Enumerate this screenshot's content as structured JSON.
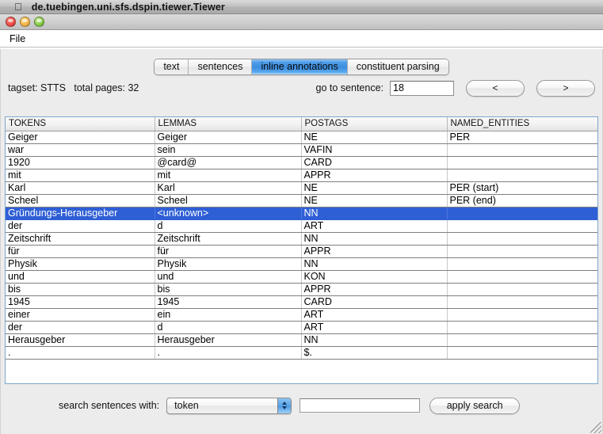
{
  "window": {
    "apple_glyph": "",
    "title": "de.tuebingen.uni.sfs.dspin.tiewer.Tiewer",
    "traffic_lights": [
      "close",
      "minimize",
      "zoom"
    ]
  },
  "menubar": {
    "items": [
      "File"
    ]
  },
  "tabs": [
    {
      "label": "text",
      "active": false
    },
    {
      "label": "sentences",
      "active": false
    },
    {
      "label": "inline annotations",
      "active": true
    },
    {
      "label": "constituent parsing",
      "active": false
    }
  ],
  "info": {
    "tagset_text": "tagset: STTS   total pages: 32",
    "tagset_label": "tagset:",
    "tagset_value": "STTS",
    "total_pages_label": "total pages:",
    "total_pages_value": "32",
    "goto_label": "go to sentence:",
    "goto_value": "18",
    "prev_label": "<",
    "next_label": ">"
  },
  "table": {
    "headers": [
      "TOKENS",
      "LEMMAS",
      "POSTAGS",
      "NAMED_ENTITIES"
    ],
    "selected_row_index": 6,
    "rows": [
      {
        "tokens": "Geiger",
        "lemmas": "Geiger",
        "postags": "NE",
        "named_entities": "PER"
      },
      {
        "tokens": "war",
        "lemmas": "sein",
        "postags": "VAFIN",
        "named_entities": ""
      },
      {
        "tokens": "1920",
        "lemmas": "@card@",
        "postags": "CARD",
        "named_entities": ""
      },
      {
        "tokens": "mit",
        "lemmas": "mit",
        "postags": "APPR",
        "named_entities": ""
      },
      {
        "tokens": "Karl",
        "lemmas": "Karl",
        "postags": "NE",
        "named_entities": "PER (start)"
      },
      {
        "tokens": "Scheel",
        "lemmas": "Scheel",
        "postags": "NE",
        "named_entities": "PER (end)"
      },
      {
        "tokens": "Gründungs-Herausgeber",
        "lemmas": "<unknown>",
        "postags": "NN",
        "named_entities": ""
      },
      {
        "tokens": "der",
        "lemmas": "d",
        "postags": "ART",
        "named_entities": ""
      },
      {
        "tokens": "Zeitschrift",
        "lemmas": "Zeitschrift",
        "postags": "NN",
        "named_entities": ""
      },
      {
        "tokens": "für",
        "lemmas": "für",
        "postags": "APPR",
        "named_entities": ""
      },
      {
        "tokens": "Physik",
        "lemmas": "Physik",
        "postags": "NN",
        "named_entities": ""
      },
      {
        "tokens": "und",
        "lemmas": "und",
        "postags": "KON",
        "named_entities": ""
      },
      {
        "tokens": "bis",
        "lemmas": "bis",
        "postags": "APPR",
        "named_entities": ""
      },
      {
        "tokens": "1945",
        "lemmas": "1945",
        "postags": "CARD",
        "named_entities": ""
      },
      {
        "tokens": "einer",
        "lemmas": "ein",
        "postags": "ART",
        "named_entities": ""
      },
      {
        "tokens": "der",
        "lemmas": "d",
        "postags": "ART",
        "named_entities": ""
      },
      {
        "tokens": "Herausgeber",
        "lemmas": "Herausgeber",
        "postags": "NN",
        "named_entities": ""
      },
      {
        "tokens": ".",
        "lemmas": ".",
        "postags": "$.",
        "named_entities": ""
      }
    ]
  },
  "search": {
    "label": "search sentences with:",
    "select_value": "token",
    "select_options": [
      "token"
    ],
    "query_value": "",
    "query_placeholder": "",
    "apply_label": "apply search"
  },
  "colors": {
    "selection_blue": "#2f5fd5",
    "active_tab_blue": "#3b8ddf",
    "panel_gray": "#ececec",
    "table_border": "#7ba7cd"
  }
}
